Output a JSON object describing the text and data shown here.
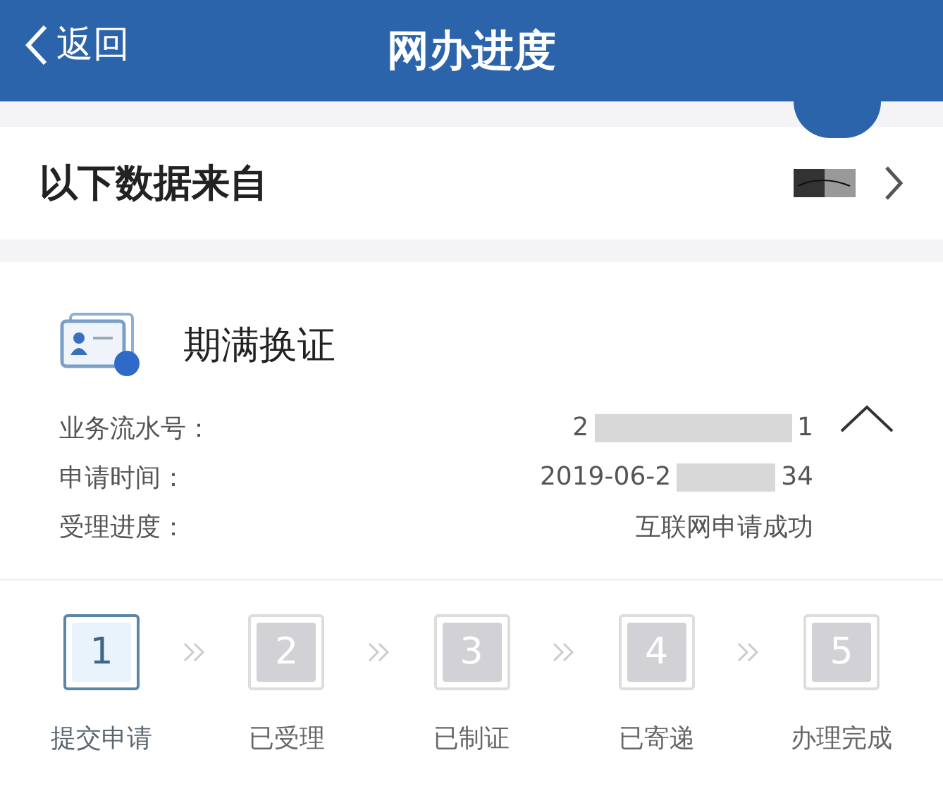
{
  "header": {
    "back_label": "返回",
    "title": "网办进度"
  },
  "source_row": {
    "label": "以下数据来自"
  },
  "business": {
    "title": "期满换证",
    "expanded": true,
    "fields": [
      {
        "label": "业务流水号：",
        "value_start": "2",
        "value_end": "1"
      },
      {
        "label": "申请时间：",
        "value_start": "2019-06-2",
        "value_end": "34"
      },
      {
        "label": "受理进度：",
        "value_start": "互联网申请成功"
      }
    ]
  },
  "steps": [
    {
      "number": "1",
      "label": "提交申请",
      "active": true
    },
    {
      "number": "2",
      "label": "已受理",
      "active": false
    },
    {
      "number": "3",
      "label": "已制证",
      "active": false
    },
    {
      "number": "4",
      "label": "已寄递",
      "active": false
    },
    {
      "number": "5",
      "label": "办理完成",
      "active": false
    }
  ]
}
